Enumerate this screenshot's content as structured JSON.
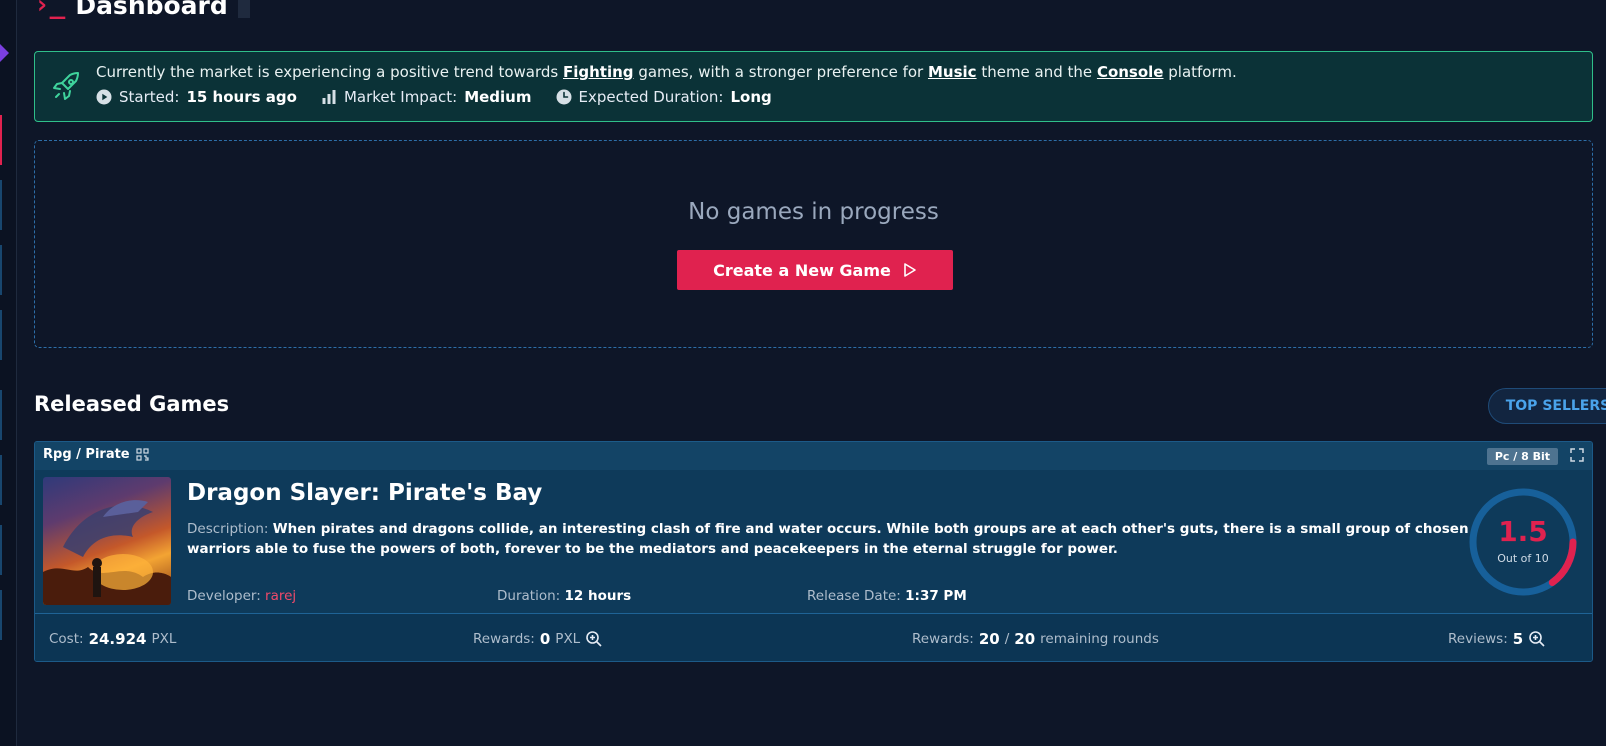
{
  "header": {
    "prompt_glyph": "›_",
    "title": "Dashboard"
  },
  "colors": {
    "accent": "#e0224f",
    "trend_border": "#2fbf8a",
    "link_blue": "#4aa3ea"
  },
  "trend": {
    "text_prefix": "Currently the market is experiencing a positive trend towards ",
    "genre": "Fighting",
    "text_mid1": " games, with a stronger preference for ",
    "theme": "Music",
    "text_mid2": " theme and the ",
    "platform": "Console",
    "text_suffix": " platform.",
    "started_label": "Started:",
    "started_value": "15 hours ago",
    "impact_label": "Market Impact:",
    "impact_value": "Medium",
    "duration_label": "Expected Duration:",
    "duration_value": "Long"
  },
  "in_progress": {
    "empty_message": "No games in progress",
    "create_button": "Create a New Game"
  },
  "released": {
    "title": "Released Games",
    "top_sellers_button": "TOP SELLERS",
    "games": [
      {
        "genre": "Rpg / Pirate",
        "platform": "Pc / 8 Bit",
        "name": "Dragon Slayer: Pirate's Bay",
        "description_label": "Description:",
        "description": "When pirates and dragons collide, an interesting clash of fire and water occurs. While both groups are at each other's guts, there is a small group of chosen warriors able to fuse the powers of both, forever to be the mediators and peacekeepers in the eternal struggle for power.",
        "developer_label": "Developer:",
        "developer": "rarej",
        "duration_label": "Duration:",
        "duration": "12 hours",
        "release_label": "Release Date:",
        "release_date": "1:37 PM",
        "score": "1.5",
        "score_max_label": "Out of 10",
        "score_fraction": 0.15,
        "cost_label": "Cost:",
        "cost_value": "24.924",
        "cost_unit": "PXL",
        "rewards_label": "Rewards:",
        "rewards_value": "0",
        "rewards_unit": "PXL",
        "rounds_label": "Rewards:",
        "rounds_remaining": "20",
        "rounds_sep": "/",
        "rounds_total": "20",
        "rounds_suffix": "remaining rounds",
        "reviews_label": "Reviews:",
        "reviews_value": "5"
      }
    ]
  }
}
